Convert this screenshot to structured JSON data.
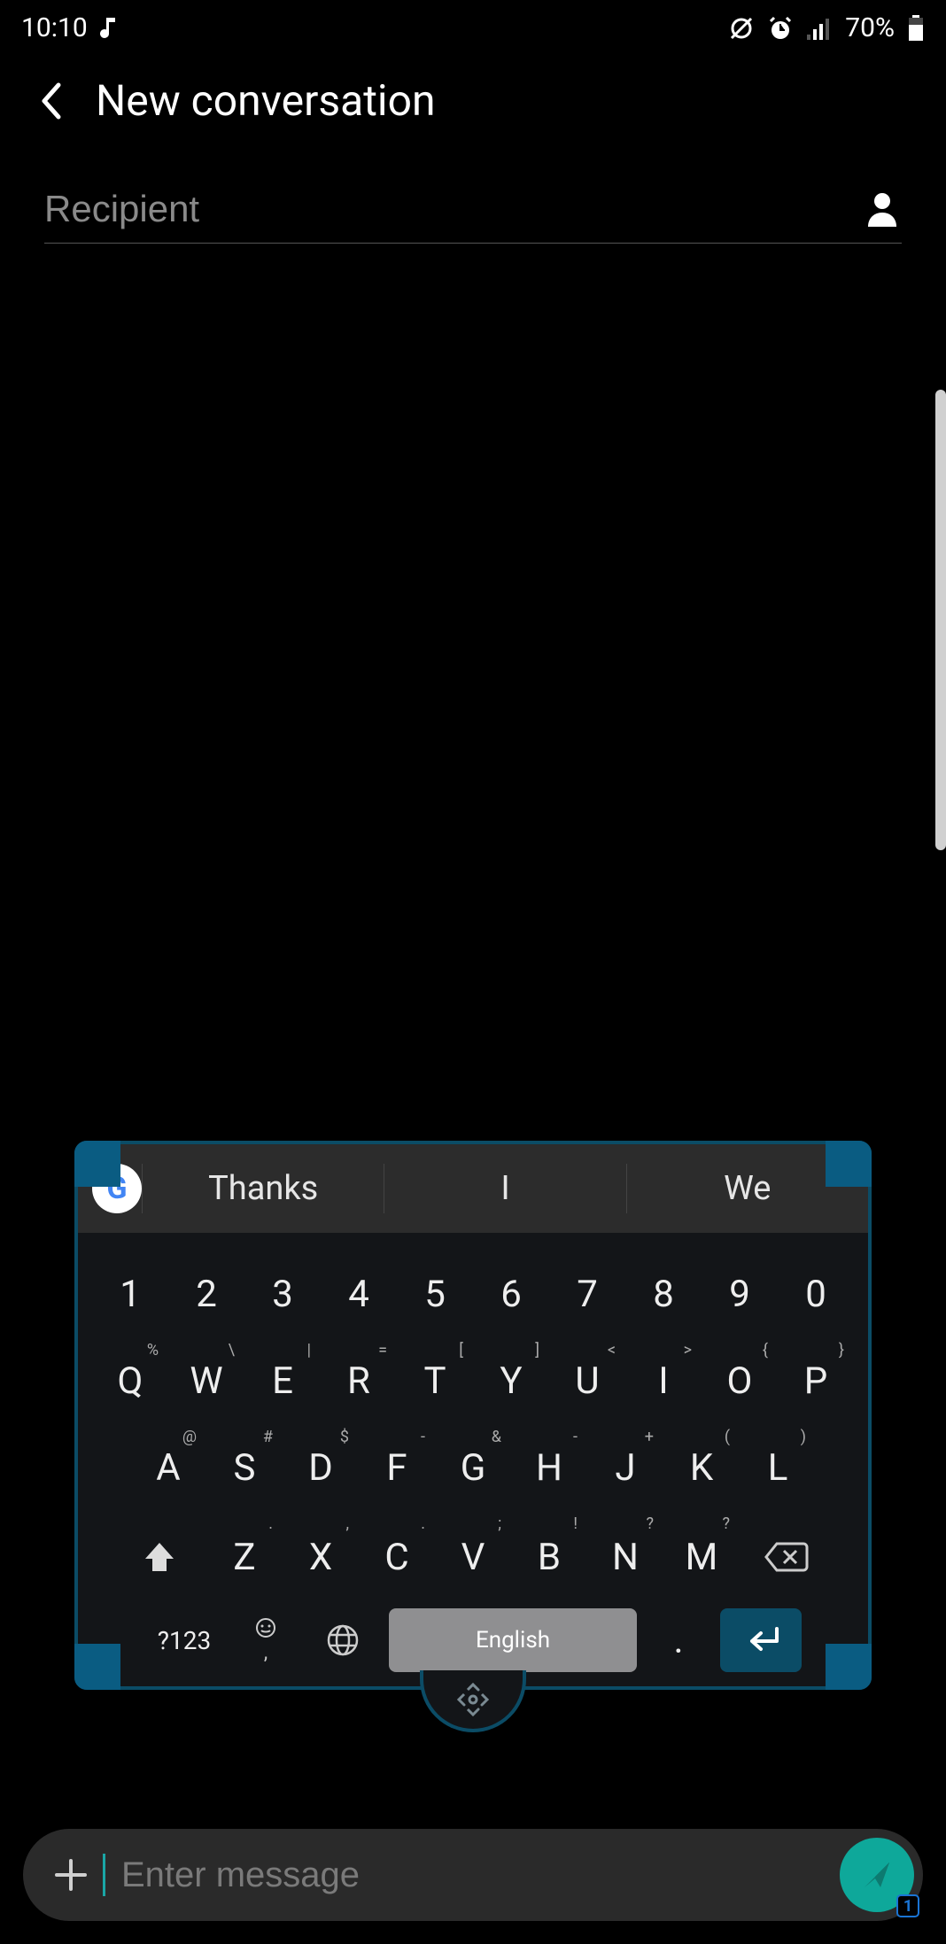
{
  "status": {
    "time": "10:10",
    "battery_text": "70%"
  },
  "header": {
    "title": "New conversation"
  },
  "recipient": {
    "placeholder": "Recipient"
  },
  "keyboard": {
    "suggestions": [
      "Thanks",
      "I",
      "We"
    ],
    "row1": [
      "1",
      "2",
      "3",
      "4",
      "5",
      "6",
      "7",
      "8",
      "9",
      "0"
    ],
    "row2": {
      "keys": [
        "Q",
        "W",
        "E",
        "R",
        "T",
        "Y",
        "U",
        "I",
        "O",
        "P"
      ],
      "alts": [
        "%",
        "\\",
        "|",
        "=",
        "[",
        "]",
        "<",
        ">",
        "{",
        "}"
      ]
    },
    "row3": {
      "keys": [
        "A",
        "S",
        "D",
        "F",
        "G",
        "H",
        "J",
        "K",
        "L"
      ],
      "alts": [
        "@",
        "#",
        "$",
        "-",
        "&",
        "-",
        "+",
        "(",
        ")"
      ]
    },
    "row4": {
      "keys": [
        "Z",
        "X",
        "C",
        "V",
        "B",
        "N",
        "M"
      ],
      "alts": [
        ".",
        ",",
        ".",
        ";",
        "!",
        "?",
        "?"
      ]
    },
    "sym_label": "?123",
    "space_label": "English",
    "period": "."
  },
  "composer": {
    "placeholder": "Enter message",
    "sim_badge": "1"
  }
}
